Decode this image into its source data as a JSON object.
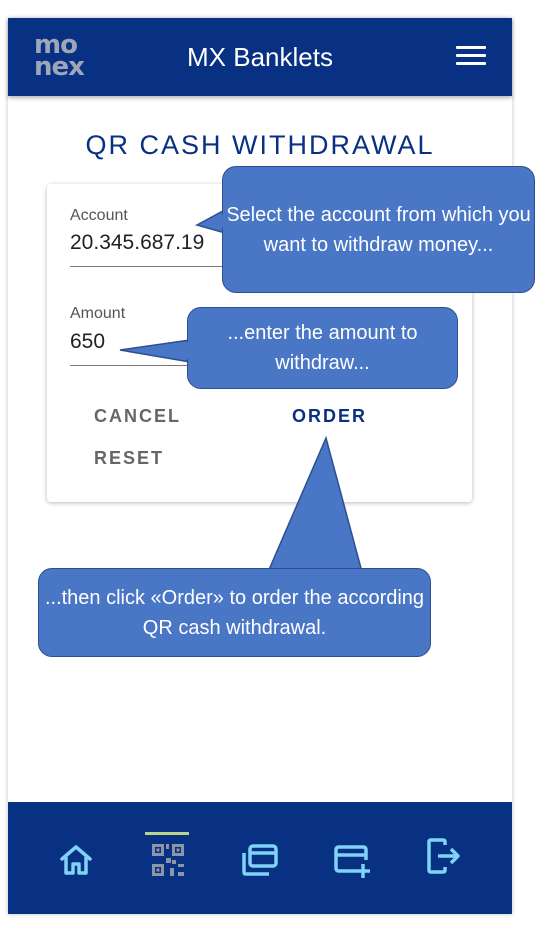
{
  "app": {
    "title": "MX Banklets",
    "logo_top": "mo",
    "logo_bottom": "nex"
  },
  "page": {
    "title": "QR CASH WITHDRAWAL"
  },
  "form": {
    "account_label": "Account",
    "account_value": "20.345.687.19",
    "amount_label": "Amount",
    "amount_value": "650",
    "cancel_label": "CANCEL",
    "order_label": "ORDER",
    "reset_label": "RESET"
  },
  "nav": {
    "items": [
      "home-icon",
      "qr-code-icon",
      "accounts-icon",
      "add-card-icon",
      "logout-icon"
    ],
    "active": "qr-code-icon",
    "active_color": "#b9d38a"
  },
  "callouts": {
    "account": "Select the account from which you want to withdraw money...",
    "amount": "...enter the amount to withdraw...",
    "order": "...then click «Order» to order the according QR cash withdrawal."
  },
  "colors": {
    "brand": "#083083",
    "callout": "#4a76c6"
  }
}
